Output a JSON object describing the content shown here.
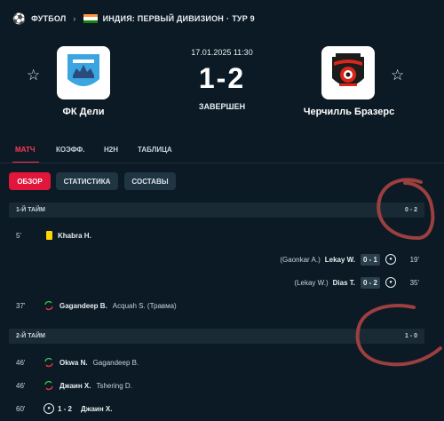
{
  "header": {
    "sport_icon": "soccer-ball-icon",
    "sport": "ФУТБОЛ",
    "flag_colors": [
      "#ff9933",
      "#ffffff",
      "#138808"
    ],
    "competition": "ИНДИЯ: ПЕРВЫЙ ДИВИЗИОН",
    "separator": "·",
    "round": "ТУР 9"
  },
  "match": {
    "datetime": "17.01.2025 11:30",
    "score": "1-2",
    "status": "ЗАВЕРШЕН",
    "home": {
      "name": "ФК Дели",
      "color": "#3aa5e0"
    },
    "away": {
      "name": "Черчилль Бразерс",
      "color": "#d8261b"
    }
  },
  "tabs": [
    {
      "label": "МАТЧ",
      "active": true
    },
    {
      "label": "КОЭФФ.",
      "active": false
    },
    {
      "label": "H2H",
      "active": false
    },
    {
      "label": "ТАБЛИЦА",
      "active": false
    }
  ],
  "subtabs": [
    {
      "label": "ОБЗОР",
      "active": true
    },
    {
      "label": "СТАТИСТИКА",
      "active": false
    },
    {
      "label": "СОСТАВЫ",
      "active": false
    }
  ],
  "halves": [
    {
      "label": "1-Й ТАЙМ",
      "result": "0 - 2"
    },
    {
      "label": "2-Й ТАЙМ",
      "result": "1 - 0"
    }
  ],
  "events": [
    {
      "minute": "5'",
      "player": "Khabra H.",
      "type": "yellow-card"
    },
    {
      "minute": "19'",
      "assist": "(Gaonkar A.)",
      "player": "Lekay W.",
      "score": "0 - 1",
      "type": "goal"
    },
    {
      "minute": "35'",
      "assist": "(Lekay W.)",
      "player": "Dias T.",
      "score": "0 - 2",
      "type": "goal"
    },
    {
      "minute": "37'",
      "player": "Gagandeep B.",
      "secondary": "Acquah S. (Травма)",
      "type": "substitution"
    },
    {
      "minute": "46'",
      "player": "Okwa N.",
      "secondary": "Gagandeep B.",
      "type": "substitution"
    },
    {
      "minute": "46'",
      "player": "Джаин Х.",
      "secondary": "Tshering D.",
      "type": "substitution"
    },
    {
      "minute": "60'",
      "score": "1 - 2",
      "player": "Джаин Х.",
      "type": "goal"
    }
  ],
  "annotation_color": "#9b3f3f"
}
